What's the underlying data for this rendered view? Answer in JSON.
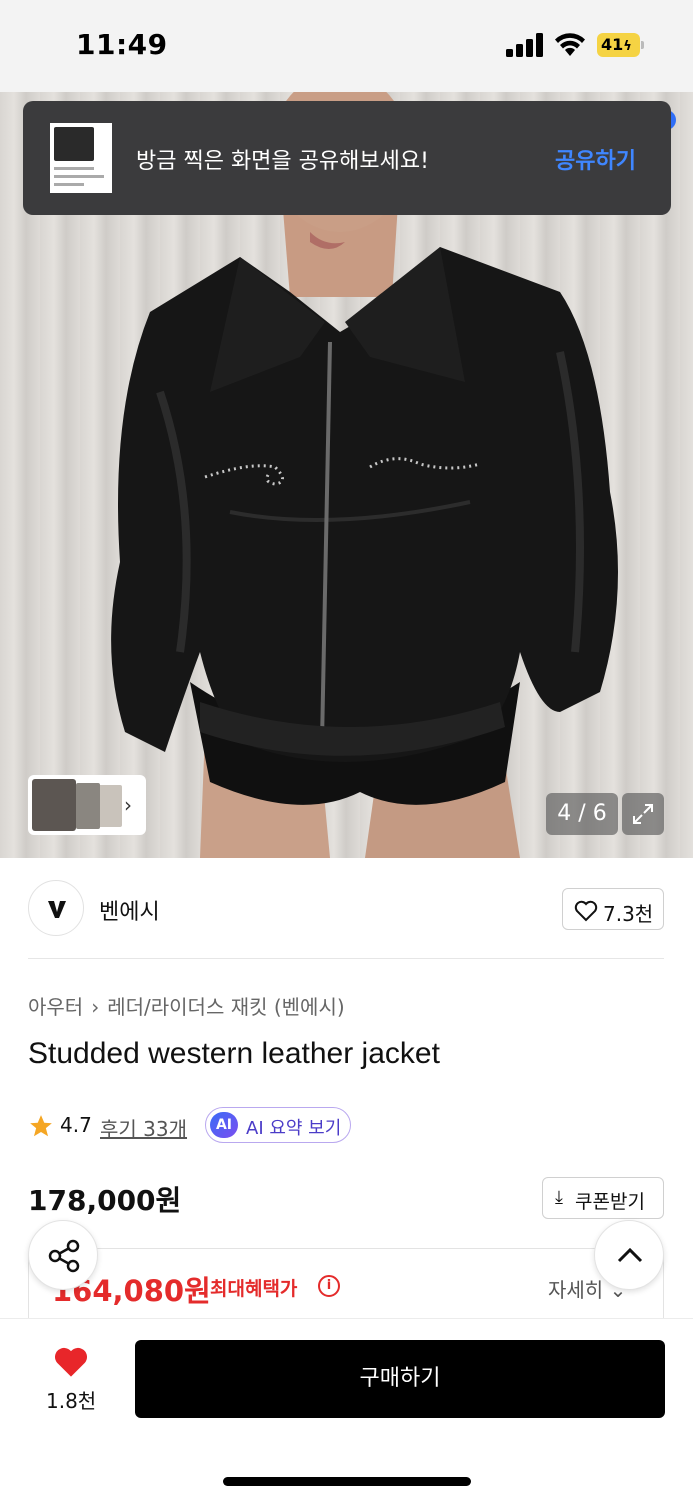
{
  "status_bar": {
    "time": "11:49",
    "battery": "41"
  },
  "toast": {
    "message": "방금 찍은 화면을 공유해보세요!",
    "action": "공유하기"
  },
  "gallery": {
    "current": 4,
    "total": 6,
    "counter": "4 / 6"
  },
  "brand": {
    "name": "벤에시",
    "likes": "7.3천"
  },
  "breadcrumb": {
    "category": "아우터",
    "subcategory": "레더/라이더스 재킷 (벤에시)"
  },
  "product": {
    "title": "Studded western leather jacket",
    "rating": "4.7",
    "reviews": "후기 33개",
    "ai_badge": "AI",
    "ai_summary": "AI 요약 보기",
    "price": "178,000원",
    "coupon": "쿠폰받기",
    "benefit_price": "164,080원",
    "benefit_label": "최대혜택가",
    "benefit_detail": "자세히"
  },
  "bottom_bar": {
    "wish_count": "1.8천",
    "buy_label": "구매하기"
  },
  "colors": {
    "accent_blue": "#3f86ff",
    "benefit_red": "#e42b2b",
    "buy_button": "#000000",
    "star": "#f5a623"
  }
}
